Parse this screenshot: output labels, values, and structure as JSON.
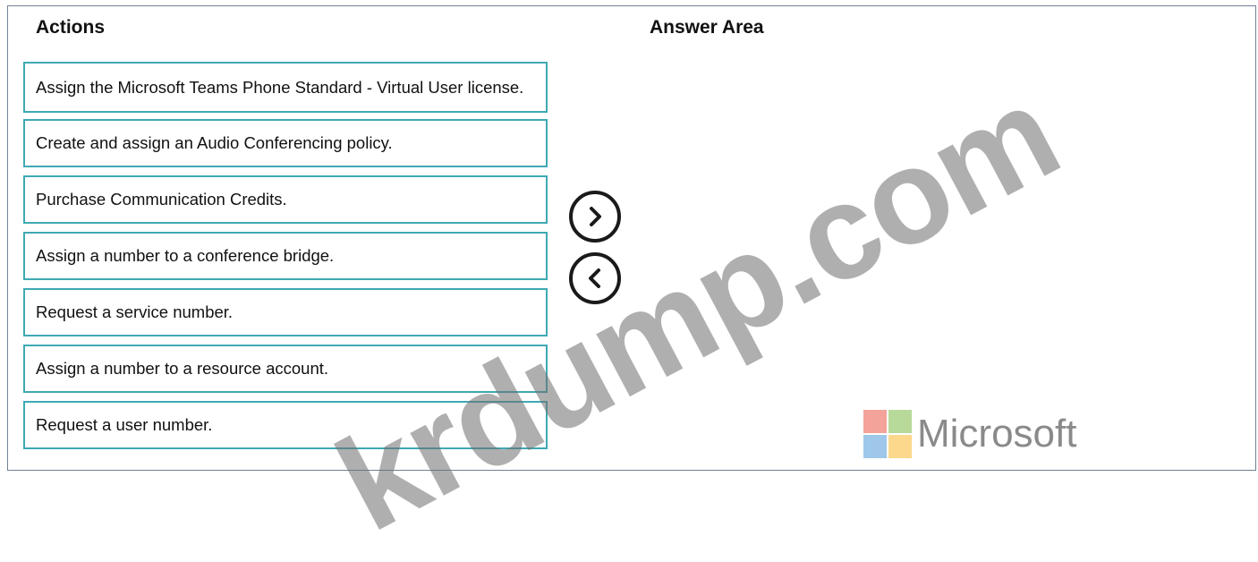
{
  "headings": {
    "actions": "Actions",
    "answer_area": "Answer Area"
  },
  "actions": [
    "Assign the Microsoft Teams Phone Standard - Virtual User license.",
    "Create and assign an Audio Conferencing policy.",
    "Purchase Communication Credits.",
    "Assign a number to a conference bridge.",
    "Request a service number.",
    "Assign a number to a resource account.",
    "Request a user number."
  ],
  "controls": {
    "move_right_icon": "chevron-right-icon",
    "move_left_icon": "chevron-left-icon"
  },
  "watermark": "krdump.com",
  "logo": {
    "text": "Microsoft",
    "colors": [
      "#f25022",
      "#7fba00",
      "#00a4ef",
      "#ffb900"
    ]
  },
  "colors": {
    "item_border": "#3fa9b3"
  }
}
